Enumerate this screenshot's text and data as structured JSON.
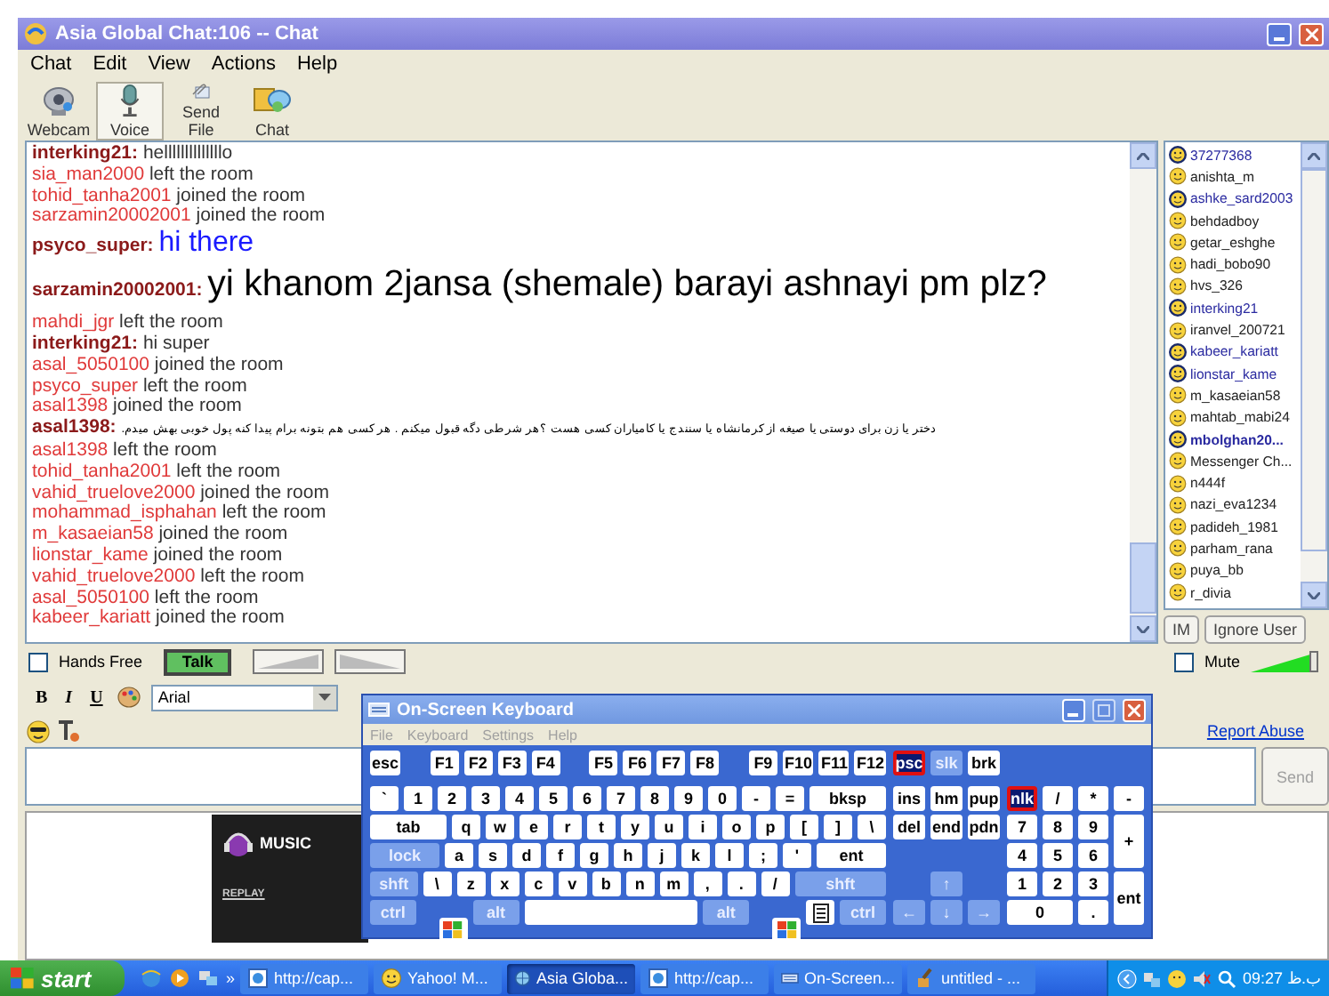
{
  "window": {
    "title": "Asia Global Chat:106 -- Chat"
  },
  "menu": [
    "Chat",
    "Edit",
    "View",
    "Actions",
    "Help"
  ],
  "toolbar": [
    {
      "label": "Webcam",
      "selected": false
    },
    {
      "label": "Voice",
      "selected": true
    },
    {
      "label": "Send File",
      "selected": false
    },
    {
      "label": "Chat",
      "selected": false
    }
  ],
  "chat": {
    "messages": [
      {
        "kind": "message",
        "name": "interking21:",
        "text": "hellllllllllllllo",
        "color": "#333333"
      },
      {
        "kind": "event",
        "name": "sia_man2000",
        "text": "left the room"
      },
      {
        "kind": "event",
        "name": "tohid_tanha2001",
        "text": "joined the room"
      },
      {
        "kind": "event",
        "name": "sarzamin20002001",
        "text": "joined the room"
      },
      {
        "kind": "large_message",
        "name": "psyco_super:",
        "text": "hi there",
        "color": "#1a1aff"
      },
      {
        "kind": "huge_message",
        "name": "sarzamin20002001:",
        "text": "yi khanom 2jansa (shemale) barayi ashnayi pm plz?",
        "color": "#000000"
      },
      {
        "kind": "event",
        "name": "mahdi_jgr",
        "text": "left the room"
      },
      {
        "kind": "message",
        "name": "interking21:",
        "text": "hi super",
        "color": "#333333"
      },
      {
        "kind": "event",
        "name": "asal_5050100",
        "text": "joined the room"
      },
      {
        "kind": "event",
        "name": "psyco_super",
        "text": "left the room"
      },
      {
        "kind": "event",
        "name": "asal1398",
        "text": "joined the room"
      },
      {
        "kind": "rtl_message",
        "name": "asal1398:",
        "text": "دختر یا زن برای دوستی یا صیغه از کرمانشاه یا سنندج یا کامیاران کسی هست ؟هر شرطی دگه قبول میکنم . هر کسی هم بتونه برام پیدا کنه پول خوبی بهش میدم.",
        "color": "#000000"
      },
      {
        "kind": "event",
        "name": "asal1398",
        "text": "left the room"
      },
      {
        "kind": "event",
        "name": "tohid_tanha2001",
        "text": "left the room"
      },
      {
        "kind": "event",
        "name": "vahid_truelove2000",
        "text": "joined the room"
      },
      {
        "kind": "event",
        "name": "mohammad_isphahan",
        "text": "left the room"
      },
      {
        "kind": "event",
        "name": "m_kasaeian58",
        "text": "joined the room"
      },
      {
        "kind": "event",
        "name": "lionstar_kame",
        "text": "joined the room"
      },
      {
        "kind": "event",
        "name": "vahid_truelove2000",
        "text": "left the room"
      },
      {
        "kind": "event",
        "name": "asal_5050100",
        "text": "left the room"
      },
      {
        "kind": "event",
        "name": "kabeer_kariatt",
        "text": "joined the room"
      }
    ]
  },
  "users": [
    {
      "name": "37277368",
      "highlighted": true,
      "bold": false
    },
    {
      "name": "anishta_m",
      "highlighted": false,
      "bold": false
    },
    {
      "name": "ashke_sard2003",
      "highlighted": true,
      "bold": false
    },
    {
      "name": "behdadboy",
      "highlighted": false,
      "bold": false
    },
    {
      "name": "getar_eshghe",
      "highlighted": false,
      "bold": false
    },
    {
      "name": "hadi_bobo90",
      "highlighted": false,
      "bold": false
    },
    {
      "name": "hvs_326",
      "highlighted": false,
      "bold": false
    },
    {
      "name": "interking21",
      "highlighted": true,
      "bold": false
    },
    {
      "name": "iranvel_200721",
      "highlighted": false,
      "bold": false
    },
    {
      "name": "kabeer_kariatt",
      "highlighted": true,
      "bold": false
    },
    {
      "name": "lionstar_kame",
      "highlighted": true,
      "bold": false
    },
    {
      "name": "m_kasaeian58",
      "highlighted": false,
      "bold": false
    },
    {
      "name": "mahtab_mabi24",
      "highlighted": false,
      "bold": false
    },
    {
      "name": "mbolghan20...",
      "highlighted": true,
      "bold": true
    },
    {
      "name": "Messenger Ch...",
      "highlighted": false,
      "bold": false
    },
    {
      "name": "n444f",
      "highlighted": false,
      "bold": false
    },
    {
      "name": "nazi_eva1234",
      "highlighted": false,
      "bold": false
    },
    {
      "name": "padideh_1981",
      "highlighted": false,
      "bold": false
    },
    {
      "name": "parham_rana",
      "highlighted": false,
      "bold": false
    },
    {
      "name": "puya_bb",
      "highlighted": false,
      "bold": false
    },
    {
      "name": "r_divia",
      "highlighted": false,
      "bold": false
    }
  ],
  "user_buttons": [
    "IM",
    "Ignore User"
  ],
  "voice": {
    "hands_free": {
      "label": "Hands Free",
      "checked": false
    },
    "talk": "Talk",
    "mute": {
      "label": "Mute",
      "checked": false
    },
    "volume": {
      "level": 0.95
    }
  },
  "format": {
    "bold": "B",
    "italic": "I",
    "underline": "U",
    "font": "Arial"
  },
  "report_abuse": "Report Abuse",
  "send": {
    "label": "Send",
    "disabled": true
  },
  "ad": {
    "brand": "MUSIC",
    "link": "REPLAY"
  },
  "keyboard": {
    "title": "On-Screen Keyboard",
    "menu": [
      "File",
      "Keyboard",
      "Settings",
      "Help"
    ],
    "main": [
      [
        {
          "label": "esc",
          "kind": "key",
          "modifier": false,
          "on": false
        },
        {
          "kind": "gap"
        },
        {
          "label": "F1",
          "kind": "key",
          "modifier": false,
          "on": false
        },
        {
          "label": "F2",
          "kind": "key",
          "modifier": false,
          "on": false
        },
        {
          "label": "F3",
          "kind": "key",
          "modifier": false,
          "on": false
        },
        {
          "label": "F4",
          "kind": "key",
          "modifier": false,
          "on": false
        },
        {
          "kind": "gap"
        },
        {
          "label": "F5",
          "kind": "key",
          "modifier": false,
          "on": false
        },
        {
          "label": "F6",
          "kind": "key",
          "modifier": false,
          "on": false
        },
        {
          "label": "F7",
          "kind": "key",
          "modifier": false,
          "on": false
        },
        {
          "label": "F8",
          "kind": "key",
          "modifier": false,
          "on": false
        },
        {
          "kind": "gap"
        },
        {
          "label": "F9",
          "kind": "key",
          "modifier": false,
          "on": false
        },
        {
          "label": "F10",
          "kind": "key",
          "modifier": false,
          "on": false
        },
        {
          "label": "F11",
          "kind": "key",
          "modifier": false,
          "on": false
        },
        {
          "label": "F12",
          "kind": "key",
          "modifier": false,
          "on": false
        }
      ],
      [
        {
          "label": "`",
          "kind": "key",
          "modifier": false,
          "on": false
        },
        {
          "label": "1",
          "kind": "key",
          "modifier": false,
          "on": false
        },
        {
          "label": "2",
          "kind": "key",
          "modifier": false,
          "on": false
        },
        {
          "label": "3",
          "kind": "key",
          "modifier": false,
          "on": false
        },
        {
          "label": "4",
          "kind": "key",
          "modifier": false,
          "on": false
        },
        {
          "label": "5",
          "kind": "key",
          "modifier": false,
          "on": false
        },
        {
          "label": "6",
          "kind": "key",
          "modifier": false,
          "on": false
        },
        {
          "label": "7",
          "kind": "key",
          "modifier": false,
          "on": false
        },
        {
          "label": "8",
          "kind": "key",
          "modifier": false,
          "on": false
        },
        {
          "label": "9",
          "kind": "key",
          "modifier": false,
          "on": false
        },
        {
          "label": "0",
          "kind": "key",
          "modifier": false,
          "on": false
        },
        {
          "label": "-",
          "kind": "key",
          "modifier": false,
          "on": false
        },
        {
          "label": "=",
          "kind": "key",
          "modifier": false,
          "on": false
        },
        {
          "label": "bksp",
          "kind": "wide",
          "modifier": false,
          "on": false
        }
      ],
      [
        {
          "label": "tab",
          "kind": "wide",
          "modifier": false,
          "on": false
        },
        {
          "label": "q",
          "kind": "key",
          "modifier": false,
          "on": false
        },
        {
          "label": "w",
          "kind": "key",
          "modifier": false,
          "on": false
        },
        {
          "label": "e",
          "kind": "key",
          "modifier": false,
          "on": false
        },
        {
          "label": "r",
          "kind": "key",
          "modifier": false,
          "on": false
        },
        {
          "label": "t",
          "kind": "key",
          "modifier": false,
          "on": false
        },
        {
          "label": "y",
          "kind": "key",
          "modifier": false,
          "on": false
        },
        {
          "label": "u",
          "kind": "key",
          "modifier": false,
          "on": false
        },
        {
          "label": "i",
          "kind": "key",
          "modifier": false,
          "on": false
        },
        {
          "label": "o",
          "kind": "key",
          "modifier": false,
          "on": false
        },
        {
          "label": "p",
          "kind": "key",
          "modifier": false,
          "on": false
        },
        {
          "label": "[",
          "kind": "key",
          "modifier": false,
          "on": false
        },
        {
          "label": "]",
          "kind": "key",
          "modifier": false,
          "on": false
        },
        {
          "label": "\\",
          "kind": "key",
          "modifier": false,
          "on": false
        }
      ],
      [
        {
          "label": "lock",
          "kind": "wide",
          "modifier": true,
          "on": false
        },
        {
          "label": "a",
          "kind": "key",
          "modifier": false,
          "on": false
        },
        {
          "label": "s",
          "kind": "key",
          "modifier": false,
          "on": false
        },
        {
          "label": "d",
          "kind": "key",
          "modifier": false,
          "on": false
        },
        {
          "label": "f",
          "kind": "key",
          "modifier": false,
          "on": false
        },
        {
          "label": "g",
          "kind": "key",
          "modifier": false,
          "on": false
        },
        {
          "label": "h",
          "kind": "key",
          "modifier": false,
          "on": false
        },
        {
          "label": "j",
          "kind": "key",
          "modifier": false,
          "on": false
        },
        {
          "label": "k",
          "kind": "key",
          "modifier": false,
          "on": false
        },
        {
          "label": "l",
          "kind": "key",
          "modifier": false,
          "on": false
        },
        {
          "label": ";",
          "kind": "key",
          "modifier": false,
          "on": false
        },
        {
          "label": "'",
          "kind": "key",
          "modifier": false,
          "on": false
        },
        {
          "label": "ent",
          "kind": "wide",
          "modifier": false,
          "on": false
        }
      ],
      [
        {
          "label": "shft",
          "kind": "wide",
          "modifier": true,
          "on": false
        },
        {
          "label": "\\",
          "kind": "key",
          "modifier": false,
          "on": false
        },
        {
          "label": "z",
          "kind": "key",
          "modifier": false,
          "on": false
        },
        {
          "label": "x",
          "kind": "key",
          "modifier": false,
          "on": false
        },
        {
          "label": "c",
          "kind": "key",
          "modifier": false,
          "on": false
        },
        {
          "label": "v",
          "kind": "key",
          "modifier": false,
          "on": false
        },
        {
          "label": "b",
          "kind": "key",
          "modifier": false,
          "on": false
        },
        {
          "label": "n",
          "kind": "key",
          "modifier": false,
          "on": false
        },
        {
          "label": "m",
          "kind": "key",
          "modifier": false,
          "on": false
        },
        {
          "label": ",",
          "kind": "key",
          "modifier": false,
          "on": false
        },
        {
          "label": ".",
          "kind": "key",
          "modifier": false,
          "on": false
        },
        {
          "label": "/",
          "kind": "key",
          "modifier": false,
          "on": false
        },
        {
          "label": "shft",
          "kind": "wider",
          "modifier": true,
          "on": false
        }
      ],
      [
        {
          "label": "ctrl",
          "kind": "wide",
          "modifier": true,
          "on": false
        },
        {
          "kind": "win",
          "modifier": false,
          "on": false
        },
        {
          "label": "alt",
          "kind": "wide",
          "modifier": true,
          "on": false
        },
        {
          "kind": "space",
          "modifier": false,
          "on": false
        },
        {
          "label": "alt",
          "kind": "wide",
          "modifier": true,
          "on": false
        },
        {
          "kind": "win",
          "modifier": false,
          "on": false
        },
        {
          "kind": "menu",
          "modifier": false,
          "on": false
        },
        {
          "label": "ctrl",
          "kind": "wide",
          "modifier": true,
          "on": false
        }
      ]
    ],
    "nav": [
      [
        {
          "label": "psc",
          "kind": "key",
          "modifier": false,
          "on": true
        },
        {
          "label": "slk",
          "kind": "key",
          "modifier": true,
          "on": false
        },
        {
          "label": "brk",
          "kind": "key",
          "modifier": false,
          "on": false
        }
      ],
      [
        {
          "label": "ins",
          "kind": "key",
          "modifier": false,
          "on": false
        },
        {
          "label": "hm",
          "kind": "key",
          "modifier": false,
          "on": false
        },
        {
          "label": "pup",
          "kind": "key",
          "modifier": false,
          "on": false
        }
      ],
      [
        {
          "label": "del",
          "kind": "key",
          "modifier": false,
          "on": false
        },
        {
          "label": "end",
          "kind": "key",
          "modifier": false,
          "on": false
        },
        {
          "label": "pdn",
          "kind": "key",
          "modifier": false,
          "on": false
        }
      ],
      [
        {
          "kind": "gap"
        },
        {
          "kind": "gap"
        },
        {
          "kind": "gap"
        }
      ],
      [
        {
          "kind": "gap"
        },
        {
          "label": "↑",
          "kind": "key",
          "modifier": true,
          "on": false
        },
        {
          "kind": "gap"
        }
      ],
      [
        {
          "label": "←",
          "kind": "key",
          "modifier": true,
          "on": false
        },
        {
          "label": "↓",
          "kind": "key",
          "modifier": true,
          "on": false
        },
        {
          "label": "→",
          "kind": "key",
          "modifier": true,
          "on": false
        }
      ]
    ],
    "numpad": [
      {
        "label": "nlk",
        "kind": "key",
        "modifier": false,
        "on": true
      },
      {
        "label": "/",
        "kind": "key",
        "modifier": false,
        "on": false
      },
      {
        "label": "*",
        "kind": "key",
        "modifier": false,
        "on": false
      },
      {
        "label": "-",
        "kind": "key",
        "modifier": false,
        "on": false
      },
      {
        "label": "7",
        "kind": "key",
        "modifier": false,
        "on": false
      },
      {
        "label": "8",
        "kind": "key",
        "modifier": false,
        "on": false
      },
      {
        "label": "9",
        "kind": "key",
        "modifier": false,
        "on": false
      },
      {
        "label": "+",
        "kind": "tall",
        "modifier": false,
        "on": false
      },
      {
        "label": "4",
        "kind": "key",
        "modifier": false,
        "on": false
      },
      {
        "label": "5",
        "kind": "key",
        "modifier": false,
        "on": false
      },
      {
        "label": "6",
        "kind": "key",
        "modifier": false,
        "on": false
      },
      {
        "label": "1",
        "kind": "key",
        "modifier": false,
        "on": false
      },
      {
        "label": "2",
        "kind": "key",
        "modifier": false,
        "on": false
      },
      {
        "label": "3",
        "kind": "key",
        "modifier": false,
        "on": false
      },
      {
        "label": "ent",
        "kind": "tall",
        "modifier": false,
        "on": false
      },
      {
        "label": "0",
        "kind": "wide2",
        "modifier": false,
        "on": false
      },
      {
        "label": ".",
        "kind": "key",
        "modifier": false,
        "on": false
      }
    ]
  },
  "taskbar": {
    "start": "start",
    "more": "»",
    "tasks": [
      {
        "label": "http://cap...",
        "selected": false
      },
      {
        "label": "Yahoo! M...",
        "selected": false
      },
      {
        "label": "Asia Globa...",
        "selected": true
      },
      {
        "label": "http://cap...",
        "selected": false
      },
      {
        "label": "On-Screen...",
        "selected": false
      },
      {
        "label": "untitled - ...",
        "selected": false
      }
    ],
    "clock": "09:27 ب.ظ"
  }
}
